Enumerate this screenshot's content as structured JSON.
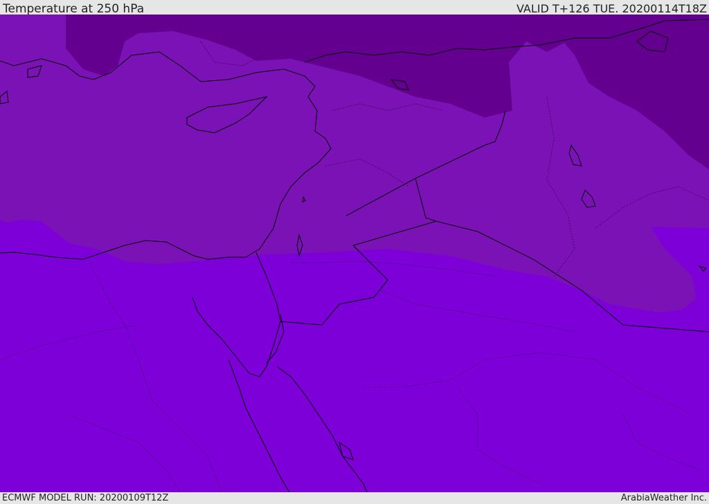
{
  "header": {
    "title": "Temperature at 250 hPa",
    "valid_time": "VALID T+126 TUE. 20200114T18Z"
  },
  "footer": {
    "model_run": "ECMWF MODEL RUN: 20200109T12Z",
    "credit": "ArabiaWeather Inc."
  },
  "map": {
    "region": "Eastern Mediterranean and Middle East",
    "colors": {
      "coldest": "#63008f",
      "cold": "#7a12b5",
      "warmer": "#7e00d8",
      "coastline": "#000000"
    }
  }
}
